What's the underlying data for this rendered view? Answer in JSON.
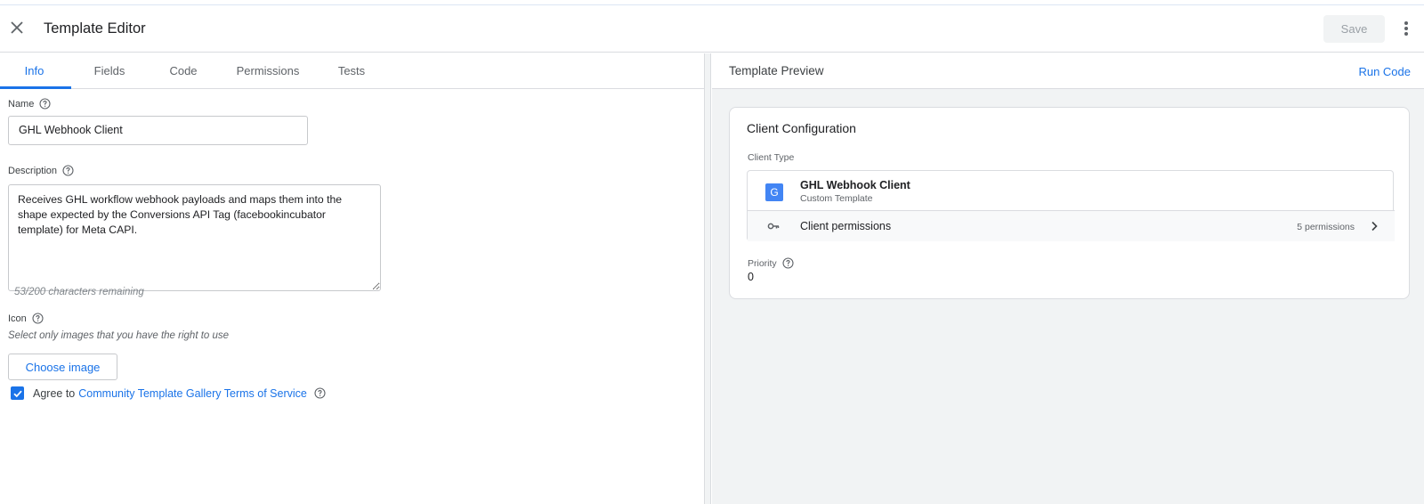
{
  "header": {
    "title": "Template Editor",
    "save_label": "Save"
  },
  "tabs": [
    {
      "label": "Info",
      "active": true
    },
    {
      "label": "Fields",
      "active": false
    },
    {
      "label": "Code",
      "active": false
    },
    {
      "label": "Permissions",
      "active": false
    },
    {
      "label": "Tests",
      "active": false
    }
  ],
  "info": {
    "name_label": "Name",
    "name_value": "GHL Webhook Client",
    "description_label": "Description",
    "description_value": "Receives GHL workflow webhook payloads and maps them into the shape expected by the Conversions API Tag (facebookincubator template) for Meta CAPI.",
    "chars_remaining": "53/200 characters remaining",
    "icon_label": "Icon",
    "icon_hint": "Select only images that you have the right to use",
    "choose_image_label": "Choose image",
    "agree_prefix": "Agree to",
    "agree_link": "Community Template Gallery Terms of Service",
    "agree_checked": true
  },
  "preview": {
    "title": "Template Preview",
    "run_code_label": "Run Code",
    "card_title": "Client Configuration",
    "client_type_label": "Client Type",
    "client_icon_letter": "G",
    "client_name": "GHL Webhook Client",
    "client_subtitle": "Custom Template",
    "permissions_label": "Client permissions",
    "permissions_count": "5 permissions",
    "priority_label": "Priority",
    "priority_value": "0"
  },
  "colors": {
    "accent": "#1a73e8",
    "client_icon_bg": "#4285f4",
    "panel_bg": "#f1f3f4"
  },
  "icons": [
    "close-icon",
    "more-vert-icon",
    "help-icon",
    "check-icon",
    "key-icon",
    "chevron-right-icon"
  ]
}
